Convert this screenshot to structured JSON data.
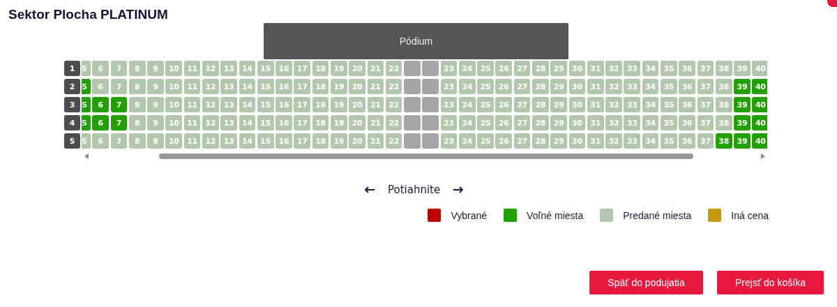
{
  "title": "Sektor Plocha PLATINUM",
  "stage": {
    "label": "Pódium"
  },
  "rows": [
    {
      "label": "1",
      "seats": [
        {
          "kind": "seat",
          "label": "5",
          "free": false
        },
        {
          "kind": "seat",
          "label": "6",
          "free": false
        },
        {
          "kind": "seat",
          "label": "7",
          "free": false
        },
        {
          "kind": "seat",
          "label": "8",
          "free": false
        },
        {
          "kind": "seat",
          "label": "9",
          "free": false
        },
        {
          "kind": "seat",
          "label": "10",
          "free": false
        },
        {
          "kind": "seat",
          "label": "11",
          "free": false
        },
        {
          "kind": "seat",
          "label": "12",
          "free": false
        },
        {
          "kind": "seat",
          "label": "13",
          "free": false
        },
        {
          "kind": "seat",
          "label": "14",
          "free": false
        },
        {
          "kind": "seat",
          "label": "15",
          "free": false
        },
        {
          "kind": "seat",
          "label": "16",
          "free": false
        },
        {
          "kind": "seat",
          "label": "17",
          "free": false
        },
        {
          "kind": "seat",
          "label": "18",
          "free": false
        },
        {
          "kind": "seat",
          "label": "19",
          "free": false
        },
        {
          "kind": "seat",
          "label": "20",
          "free": false
        },
        {
          "kind": "seat",
          "label": "21",
          "free": false
        },
        {
          "kind": "seat",
          "label": "22",
          "free": false
        },
        {
          "kind": "aisle"
        },
        {
          "kind": "aisle"
        },
        {
          "kind": "seat",
          "label": "23",
          "free": false
        },
        {
          "kind": "seat",
          "label": "24",
          "free": false
        },
        {
          "kind": "seat",
          "label": "25",
          "free": false
        },
        {
          "kind": "seat",
          "label": "26",
          "free": false
        },
        {
          "kind": "seat",
          "label": "27",
          "free": false
        },
        {
          "kind": "seat",
          "label": "28",
          "free": false
        },
        {
          "kind": "seat",
          "label": "29",
          "free": false
        },
        {
          "kind": "seat",
          "label": "30",
          "free": false
        },
        {
          "kind": "seat",
          "label": "31",
          "free": false
        },
        {
          "kind": "seat",
          "label": "32",
          "free": false
        },
        {
          "kind": "seat",
          "label": "33",
          "free": false
        },
        {
          "kind": "seat",
          "label": "34",
          "free": false
        },
        {
          "kind": "seat",
          "label": "35",
          "free": false
        },
        {
          "kind": "seat",
          "label": "36",
          "free": false
        },
        {
          "kind": "seat",
          "label": "37",
          "free": false
        },
        {
          "kind": "seat",
          "label": "38",
          "free": false
        },
        {
          "kind": "seat",
          "label": "39",
          "free": false
        },
        {
          "kind": "seat",
          "label": "40",
          "free": false
        }
      ]
    },
    {
      "label": "2",
      "seats": [
        {
          "kind": "seat",
          "label": "5",
          "free": true
        },
        {
          "kind": "seat",
          "label": "6",
          "free": false
        },
        {
          "kind": "seat",
          "label": "7",
          "free": false
        },
        {
          "kind": "seat",
          "label": "8",
          "free": false
        },
        {
          "kind": "seat",
          "label": "9",
          "free": false
        },
        {
          "kind": "seat",
          "label": "10",
          "free": false
        },
        {
          "kind": "seat",
          "label": "11",
          "free": false
        },
        {
          "kind": "seat",
          "label": "12",
          "free": false
        },
        {
          "kind": "seat",
          "label": "13",
          "free": false
        },
        {
          "kind": "seat",
          "label": "14",
          "free": false
        },
        {
          "kind": "seat",
          "label": "15",
          "free": false
        },
        {
          "kind": "seat",
          "label": "16",
          "free": false
        },
        {
          "kind": "seat",
          "label": "17",
          "free": false
        },
        {
          "kind": "seat",
          "label": "18",
          "free": false
        },
        {
          "kind": "seat",
          "label": "19",
          "free": false
        },
        {
          "kind": "seat",
          "label": "20",
          "free": false
        },
        {
          "kind": "seat",
          "label": "21",
          "free": false
        },
        {
          "kind": "seat",
          "label": "22",
          "free": false
        },
        {
          "kind": "aisle"
        },
        {
          "kind": "aisle"
        },
        {
          "kind": "seat",
          "label": "23",
          "free": false
        },
        {
          "kind": "seat",
          "label": "24",
          "free": false
        },
        {
          "kind": "seat",
          "label": "25",
          "free": false
        },
        {
          "kind": "seat",
          "label": "26",
          "free": false
        },
        {
          "kind": "seat",
          "label": "27",
          "free": false
        },
        {
          "kind": "seat",
          "label": "28",
          "free": false
        },
        {
          "kind": "seat",
          "label": "29",
          "free": false
        },
        {
          "kind": "seat",
          "label": "30",
          "free": false
        },
        {
          "kind": "seat",
          "label": "31",
          "free": false
        },
        {
          "kind": "seat",
          "label": "32",
          "free": false
        },
        {
          "kind": "seat",
          "label": "33",
          "free": false
        },
        {
          "kind": "seat",
          "label": "34",
          "free": false
        },
        {
          "kind": "seat",
          "label": "35",
          "free": false
        },
        {
          "kind": "seat",
          "label": "36",
          "free": false
        },
        {
          "kind": "seat",
          "label": "37",
          "free": false
        },
        {
          "kind": "seat",
          "label": "38",
          "free": false
        },
        {
          "kind": "seat",
          "label": "39",
          "free": true
        },
        {
          "kind": "seat",
          "label": "40",
          "free": true
        }
      ]
    },
    {
      "label": "3",
      "seats": [
        {
          "kind": "seat",
          "label": "5",
          "free": true
        },
        {
          "kind": "seat",
          "label": "6",
          "free": true
        },
        {
          "kind": "seat",
          "label": "7",
          "free": true
        },
        {
          "kind": "seat",
          "label": "8",
          "free": false
        },
        {
          "kind": "seat",
          "label": "9",
          "free": false
        },
        {
          "kind": "seat",
          "label": "10",
          "free": false
        },
        {
          "kind": "seat",
          "label": "11",
          "free": false
        },
        {
          "kind": "seat",
          "label": "12",
          "free": false
        },
        {
          "kind": "seat",
          "label": "13",
          "free": false
        },
        {
          "kind": "seat",
          "label": "14",
          "free": false
        },
        {
          "kind": "seat",
          "label": "15",
          "free": false
        },
        {
          "kind": "seat",
          "label": "16",
          "free": false
        },
        {
          "kind": "seat",
          "label": "17",
          "free": false
        },
        {
          "kind": "seat",
          "label": "18",
          "free": false
        },
        {
          "kind": "seat",
          "label": "19",
          "free": false
        },
        {
          "kind": "seat",
          "label": "20",
          "free": false
        },
        {
          "kind": "seat",
          "label": "21",
          "free": false
        },
        {
          "kind": "seat",
          "label": "22",
          "free": false
        },
        {
          "kind": "aisle"
        },
        {
          "kind": "aisle"
        },
        {
          "kind": "seat",
          "label": "23",
          "free": false
        },
        {
          "kind": "seat",
          "label": "24",
          "free": false
        },
        {
          "kind": "seat",
          "label": "25",
          "free": false
        },
        {
          "kind": "seat",
          "label": "26",
          "free": false
        },
        {
          "kind": "seat",
          "label": "27",
          "free": false
        },
        {
          "kind": "seat",
          "label": "28",
          "free": false
        },
        {
          "kind": "seat",
          "label": "29",
          "free": false
        },
        {
          "kind": "seat",
          "label": "30",
          "free": false
        },
        {
          "kind": "seat",
          "label": "31",
          "free": false
        },
        {
          "kind": "seat",
          "label": "32",
          "free": false
        },
        {
          "kind": "seat",
          "label": "33",
          "free": false
        },
        {
          "kind": "seat",
          "label": "34",
          "free": false
        },
        {
          "kind": "seat",
          "label": "35",
          "free": false
        },
        {
          "kind": "seat",
          "label": "36",
          "free": false
        },
        {
          "kind": "seat",
          "label": "37",
          "free": false
        },
        {
          "kind": "seat",
          "label": "38",
          "free": false
        },
        {
          "kind": "seat",
          "label": "39",
          "free": true
        },
        {
          "kind": "seat",
          "label": "40",
          "free": true
        }
      ]
    },
    {
      "label": "4",
      "seats": [
        {
          "kind": "seat",
          "label": "5",
          "free": true
        },
        {
          "kind": "seat",
          "label": "6",
          "free": true
        },
        {
          "kind": "seat",
          "label": "7",
          "free": true
        },
        {
          "kind": "seat",
          "label": "8",
          "free": false
        },
        {
          "kind": "seat",
          "label": "9",
          "free": false
        },
        {
          "kind": "seat",
          "label": "10",
          "free": false
        },
        {
          "kind": "seat",
          "label": "11",
          "free": false
        },
        {
          "kind": "seat",
          "label": "12",
          "free": false
        },
        {
          "kind": "seat",
          "label": "13",
          "free": false
        },
        {
          "kind": "seat",
          "label": "14",
          "free": false
        },
        {
          "kind": "seat",
          "label": "15",
          "free": false
        },
        {
          "kind": "seat",
          "label": "16",
          "free": false
        },
        {
          "kind": "seat",
          "label": "17",
          "free": false
        },
        {
          "kind": "seat",
          "label": "18",
          "free": false
        },
        {
          "kind": "seat",
          "label": "19",
          "free": false
        },
        {
          "kind": "seat",
          "label": "20",
          "free": false
        },
        {
          "kind": "seat",
          "label": "21",
          "free": false
        },
        {
          "kind": "seat",
          "label": "22",
          "free": false
        },
        {
          "kind": "aisle"
        },
        {
          "kind": "aisle"
        },
        {
          "kind": "seat",
          "label": "23",
          "free": false
        },
        {
          "kind": "seat",
          "label": "24",
          "free": false
        },
        {
          "kind": "seat",
          "label": "25",
          "free": false
        },
        {
          "kind": "seat",
          "label": "26",
          "free": false
        },
        {
          "kind": "seat",
          "label": "27",
          "free": false
        },
        {
          "kind": "seat",
          "label": "28",
          "free": false
        },
        {
          "kind": "seat",
          "label": "29",
          "free": false
        },
        {
          "kind": "seat",
          "label": "30",
          "free": false
        },
        {
          "kind": "seat",
          "label": "31",
          "free": false
        },
        {
          "kind": "seat",
          "label": "32",
          "free": false
        },
        {
          "kind": "seat",
          "label": "33",
          "free": false
        },
        {
          "kind": "seat",
          "label": "34",
          "free": false
        },
        {
          "kind": "seat",
          "label": "35",
          "free": false
        },
        {
          "kind": "seat",
          "label": "36",
          "free": false
        },
        {
          "kind": "seat",
          "label": "37",
          "free": false
        },
        {
          "kind": "seat",
          "label": "38",
          "free": false
        },
        {
          "kind": "seat",
          "label": "39",
          "free": true
        },
        {
          "kind": "seat",
          "label": "40",
          "free": true
        }
      ]
    },
    {
      "label": "5",
      "seats": [
        {
          "kind": "seat",
          "label": "5",
          "free": false
        },
        {
          "kind": "seat",
          "label": "6",
          "free": false
        },
        {
          "kind": "seat",
          "label": "7",
          "free": false
        },
        {
          "kind": "seat",
          "label": "8",
          "free": false
        },
        {
          "kind": "seat",
          "label": "9",
          "free": false
        },
        {
          "kind": "seat",
          "label": "10",
          "free": false
        },
        {
          "kind": "seat",
          "label": "11",
          "free": false
        },
        {
          "kind": "seat",
          "label": "12",
          "free": false
        },
        {
          "kind": "seat",
          "label": "13",
          "free": false
        },
        {
          "kind": "seat",
          "label": "14",
          "free": false
        },
        {
          "kind": "seat",
          "label": "15",
          "free": false
        },
        {
          "kind": "seat",
          "label": "16",
          "free": false
        },
        {
          "kind": "seat",
          "label": "17",
          "free": false
        },
        {
          "kind": "seat",
          "label": "18",
          "free": false
        },
        {
          "kind": "seat",
          "label": "19",
          "free": false
        },
        {
          "kind": "seat",
          "label": "20",
          "free": false
        },
        {
          "kind": "seat",
          "label": "21",
          "free": false
        },
        {
          "kind": "seat",
          "label": "22",
          "free": false
        },
        {
          "kind": "aisle"
        },
        {
          "kind": "aisle"
        },
        {
          "kind": "seat",
          "label": "23",
          "free": false
        },
        {
          "kind": "seat",
          "label": "24",
          "free": false
        },
        {
          "kind": "seat",
          "label": "25",
          "free": false
        },
        {
          "kind": "seat",
          "label": "26",
          "free": false
        },
        {
          "kind": "seat",
          "label": "27",
          "free": false
        },
        {
          "kind": "seat",
          "label": "28",
          "free": false
        },
        {
          "kind": "seat",
          "label": "29",
          "free": false
        },
        {
          "kind": "seat",
          "label": "30",
          "free": false
        },
        {
          "kind": "seat",
          "label": "31",
          "free": false
        },
        {
          "kind": "seat",
          "label": "32",
          "free": false
        },
        {
          "kind": "seat",
          "label": "33",
          "free": false
        },
        {
          "kind": "seat",
          "label": "34",
          "free": false
        },
        {
          "kind": "seat",
          "label": "35",
          "free": false
        },
        {
          "kind": "seat",
          "label": "36",
          "free": false
        },
        {
          "kind": "seat",
          "label": "37",
          "free": false
        },
        {
          "kind": "seat",
          "label": "38",
          "free": true
        },
        {
          "kind": "seat",
          "label": "39",
          "free": true
        },
        {
          "kind": "seat",
          "label": "40",
          "free": true
        }
      ]
    }
  ],
  "drag_hint": {
    "label": "Potiahnite"
  },
  "legend": [
    {
      "label": "Vybrané",
      "color": "#c00000"
    },
    {
      "label": "Voľné miesta",
      "color": "#21a000"
    },
    {
      "label": "Predané miesta",
      "color": "#b3c7b0"
    },
    {
      "label": "Iná cena",
      "color": "#c49a00"
    }
  ],
  "buttons": [
    {
      "label": "Späť do podujatia"
    },
    {
      "label": "Prejsť do košíka"
    }
  ]
}
